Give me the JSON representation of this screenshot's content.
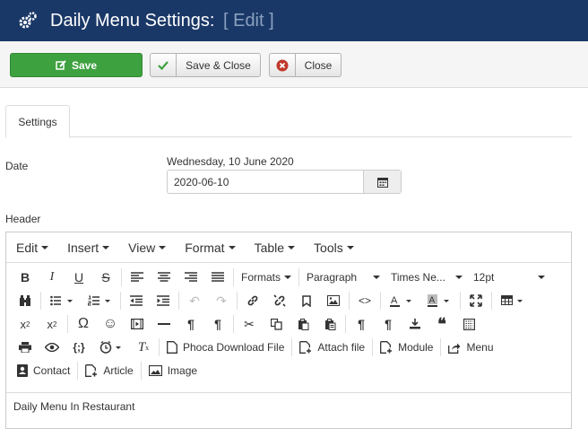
{
  "title": {
    "main": "Daily Menu Settings:",
    "edit": "[ Edit ]"
  },
  "toolbar": {
    "save": "Save",
    "save_close": "Save & Close",
    "close": "Close"
  },
  "tabs": [
    {
      "label": "Settings"
    }
  ],
  "date": {
    "label": "Date",
    "display": "Wednesday, 10 June 2020",
    "value": "2020-06-10"
  },
  "header": {
    "label": "Header"
  },
  "menubar": [
    "Edit",
    "Insert",
    "View",
    "Format",
    "Table",
    "Tools"
  ],
  "dropdowns": {
    "formats": "Formats",
    "block": "Paragraph",
    "font": "Times Ne...",
    "size": "12pt"
  },
  "plugins": {
    "phoca": "Phoca Download File",
    "attach": "Attach file",
    "module": "Module",
    "menu": "Menu",
    "contact": "Contact",
    "article": "Article",
    "image": "Image"
  },
  "content": "Daily Menu In Restaurant",
  "colors": {
    "titlebar": "#1a3867",
    "save": "#3ea140"
  }
}
